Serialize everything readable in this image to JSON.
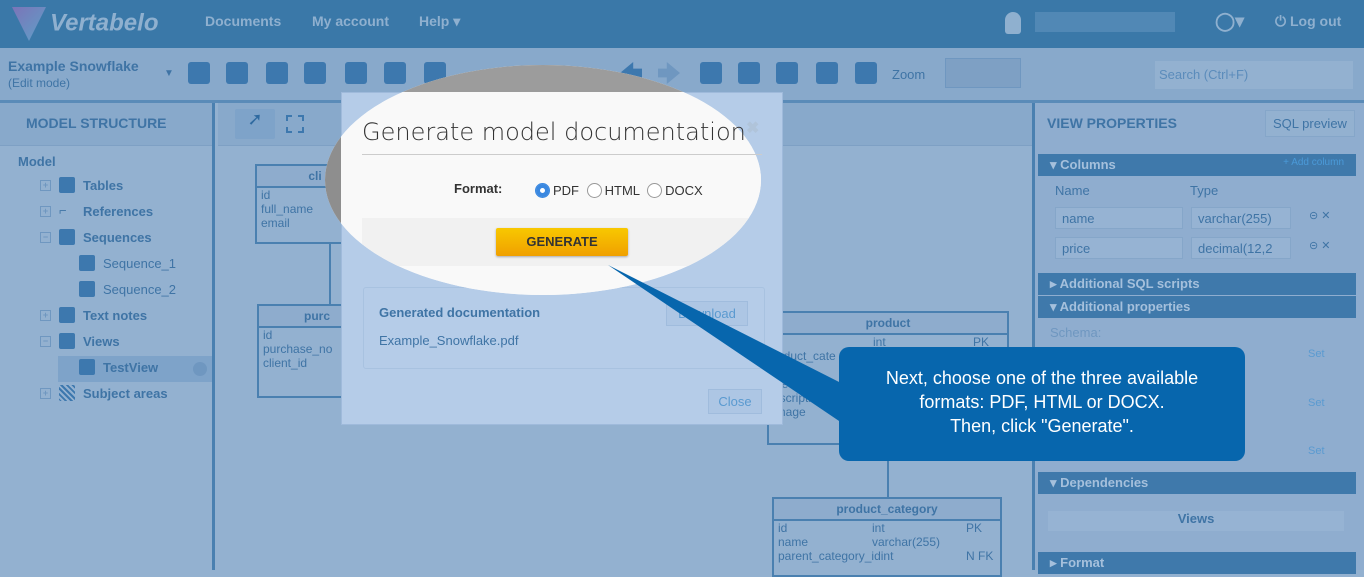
{
  "app": {
    "logo": "Vertabelo",
    "nav": [
      "Documents",
      "My account",
      "Help"
    ],
    "logout": "Log out"
  },
  "doc": {
    "title": "Example Snowflake",
    "mode": "(Edit mode)",
    "zoom": "Zoom",
    "search_placeholder": "Search (Ctrl+F)"
  },
  "left": {
    "header": "MODEL STRUCTURE",
    "root": "Model",
    "items": [
      "Tables",
      "References",
      "Sequences",
      "Sequence_1",
      "Sequence_2",
      "Text notes",
      "Views",
      "TestView",
      "Subject areas"
    ]
  },
  "tables": {
    "client": {
      "name": "cli",
      "cols": [
        "id",
        "full_name",
        "email"
      ]
    },
    "purchase": {
      "name": "purc",
      "cols": [
        "id",
        "purchase_no",
        "client_id"
      ]
    },
    "product": {
      "name": "product",
      "rows": [
        [
          "",
          "int",
          "PK"
        ],
        [
          "roduct_cate",
          "",
          ""
        ],
        [
          "ame",
          "",
          ""
        ],
        [
          "ice",
          "",
          ""
        ],
        [
          "escription",
          "",
          ""
        ],
        [
          "image",
          "",
          ""
        ]
      ]
    },
    "product_category": {
      "name": "product_category",
      "rows": [
        [
          "id",
          "int",
          "PK"
        ],
        [
          "name",
          "varchar(255)",
          ""
        ],
        [
          "parent_category_id",
          "int",
          "N FK"
        ]
      ]
    }
  },
  "dialog": {
    "title": "Generate model documentation",
    "format_label": "Format:",
    "formats": [
      "PDF",
      "HTML",
      "DOCX"
    ],
    "selected": "PDF",
    "generate": "GENERATE",
    "generated_title": "Generated documentation",
    "file": "Example_Snowflake.pdf",
    "download": "Download",
    "close": "Close"
  },
  "tooltip": {
    "lines": [
      "Next, choose one of the three available",
      "formats: PDF, HTML or DOCX.",
      "Then, click \"Generate\"."
    ]
  },
  "right": {
    "header": "VIEW PROPERTIES",
    "sql_preview": "SQL preview",
    "columns": "Columns",
    "add_column": "+ Add column",
    "col_headers": [
      "Name",
      "Type"
    ],
    "rows": [
      {
        "name": "name",
        "type": "varchar(255)"
      },
      {
        "name": "price",
        "type": "decimal(12,2"
      }
    ],
    "sql_scripts": "Additional SQL scripts",
    "additional": "Additional properties",
    "schema": "Schema:",
    "set": "Set",
    "dependencies": "Dependencies",
    "views": "Views",
    "format": "Format"
  },
  "colors": {
    "accent": "#0766ad",
    "generate": "#f5b400"
  }
}
